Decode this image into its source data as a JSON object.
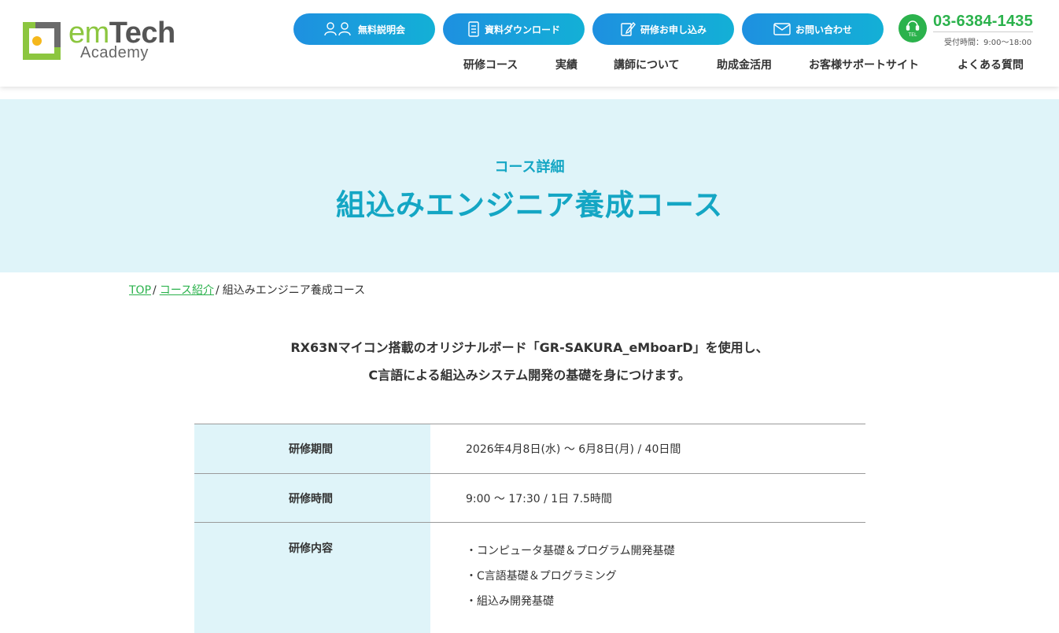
{
  "header": {
    "logo": {
      "em": "em",
      "tech": "Tech",
      "academy": "Academy"
    },
    "buttons": [
      {
        "label": "無料説明会",
        "icon": "users-icon"
      },
      {
        "label": "資料ダウンロード",
        "icon": "document-icon"
      },
      {
        "label": "研修お申し込み",
        "icon": "edit-icon"
      },
      {
        "label": "お問い合わせ",
        "icon": "mail-icon"
      }
    ],
    "tel": {
      "badge": "TEL",
      "number": "03-6384-1435",
      "hours": "受付時間：9:00〜18:00"
    },
    "nav": [
      "研修コース",
      "実績",
      "講師について",
      "助成金活用",
      "お客様サポートサイト",
      "よくある質問"
    ]
  },
  "hero": {
    "subtitle": "コース詳細",
    "title": "組込みエンジニア養成コース"
  },
  "breadcrumb": {
    "home": "TOP",
    "courses": "コース紹介",
    "current": "組込みエンジニア養成コース",
    "separator": "/"
  },
  "lead": {
    "line1": "RX63Nマイコン搭載のオリジナルボード「GR-SAKURA_eMboarD」を使用し、",
    "line2": "C言語による組込みシステム開発の基礎を身につけます。"
  },
  "table": {
    "period_label": "研修期間",
    "period_value": "2026年4月8日(水) 〜 6月8日(月) / 40日間",
    "time_label": "研修時間",
    "time_value": "9:00 〜 17:30 / 1日 7.5時間",
    "content_label": "研修内容",
    "content_items": [
      "・コンピュータ基礎＆プログラム開発基礎",
      "・C言語基礎＆プログラミング",
      "・組込み開発基礎"
    ]
  },
  "colors": {
    "accent": "#14a6c4",
    "green": "#2bb24c",
    "hero_bg": "#dff4f9"
  }
}
